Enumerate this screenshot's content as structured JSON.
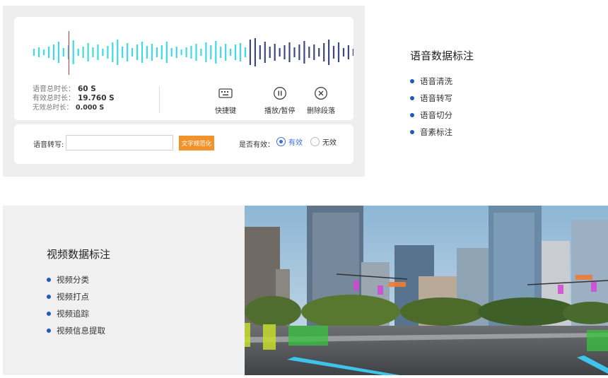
{
  "audio": {
    "stats": [
      {
        "label": "语音总时长：",
        "value": "60 S"
      },
      {
        "label": "有效总时长：",
        "value": "19.760 S"
      },
      {
        "label": "无效总时长：",
        "value": "0.000 S"
      }
    ],
    "controls": {
      "keyboard_label": "快捷键",
      "play_label": "播放/暂停",
      "delete_label": "删除段落"
    },
    "transcription": {
      "label": "语音转写:",
      "value": "",
      "normalize_label": "文字规范化",
      "valid_label": "是否有效：",
      "options": [
        "有效",
        "无效"
      ],
      "selected": "有效"
    },
    "colors": {
      "wave_active": "#3ddbe4",
      "wave_inactive": "#3f4a7c",
      "accent": "#f1932a",
      "radio": "#3a6fd8"
    },
    "feature_title": "语音数据标注",
    "features": [
      "语音清洗",
      "语音转写",
      "语音切分",
      "音素标注"
    ]
  },
  "video": {
    "feature_title": "视频数据标注",
    "features": [
      "视频分类",
      "视频打点",
      "视频追踪",
      "视频信息提取"
    ],
    "bullet_color": "#1e5bb8"
  }
}
